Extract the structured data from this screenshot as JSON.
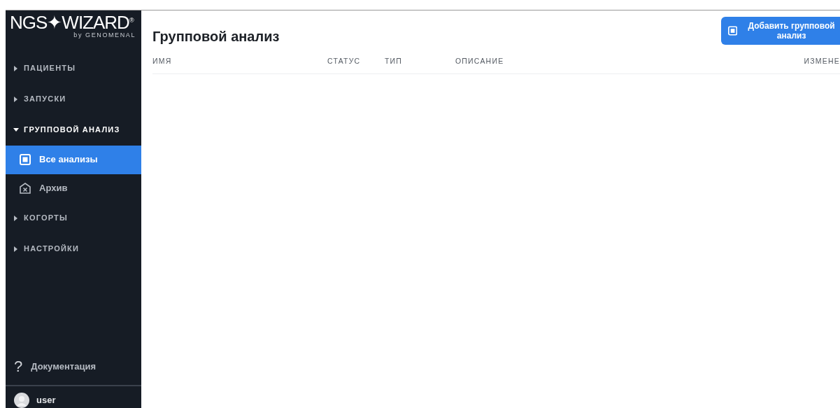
{
  "logo": {
    "text": "NGS✦WIZARD$^{®}$",
    "subtitle": "by GENOMENAL"
  },
  "sidebar": {
    "items": [
      {
        "label": "ПАЦИЕНТЫ",
        "expanded": false
      },
      {
        "label": "ЗАПУСКИ",
        "expanded": false
      },
      {
        "label": "ГРУППОВОЙ АНАЛИЗ",
        "expanded": true,
        "children": [
          {
            "label": "Все анализы",
            "kind": "stack",
            "selected": true
          },
          {
            "label": "Архив",
            "kind": "archive",
            "selected": false
          }
        ]
      },
      {
        "label": "КОГОРТЫ",
        "expanded": false
      },
      {
        "label": "НАСТРОЙКИ",
        "expanded": false
      }
    ],
    "help": {
      "icon": "?",
      "label": "Документация"
    },
    "user": {
      "name": "user"
    }
  },
  "page": {
    "title": "Групповой анализ",
    "add_button": "Добавить групповой анализ"
  },
  "table": {
    "columns": [
      "ИМЯ",
      "СТАТУС",
      "ТИП",
      "ОПИСАНИЕ",
      "ИЗМЕНЕ"
    ]
  }
}
